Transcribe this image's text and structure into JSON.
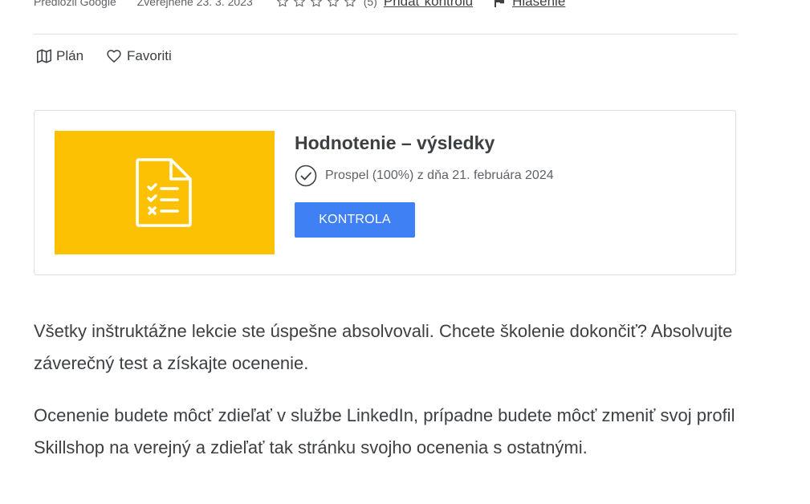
{
  "meta": {
    "provider": "Predložil Google",
    "published": "Zverejnené 23. 3. 2023",
    "rating_count": "(5)",
    "add_review": "Pridať kontrolu",
    "report": "Hlásenie"
  },
  "actions": {
    "plan": "Plán",
    "favorites": "Favoriti"
  },
  "assessment": {
    "title": "Hodnotenie – výsledky",
    "status": "Prospel (100%) z dňa 21. februára 2024",
    "button": "KONTROLA",
    "thumb_color": "#fbc102",
    "button_color": "#3f80f4"
  },
  "content": {
    "paragraph1": "Všetky inštruktážne lekcie ste úspešne absolvovali. Chcete školenie dokončiť? Absolvujte záverečný test a získajte ocenenie.",
    "paragraph2": "Ocenenie budete môcť zdieľať v službe LinkedIn, prípadne budete môcť zmeniť svoj profil Skillshop na verejný a zdieľať tak stránku svojho ocenenia s ostatnými."
  },
  "icons": {
    "stars": [
      "star-outline-icon",
      "star-outline-icon",
      "star-outline-icon",
      "star-outline-icon",
      "star-outline-icon"
    ],
    "report": "flag-icon",
    "plan": "map-icon",
    "favorites": "heart-outline-icon",
    "thumb": "checklist-document-icon",
    "status": "check-circle-icon"
  }
}
